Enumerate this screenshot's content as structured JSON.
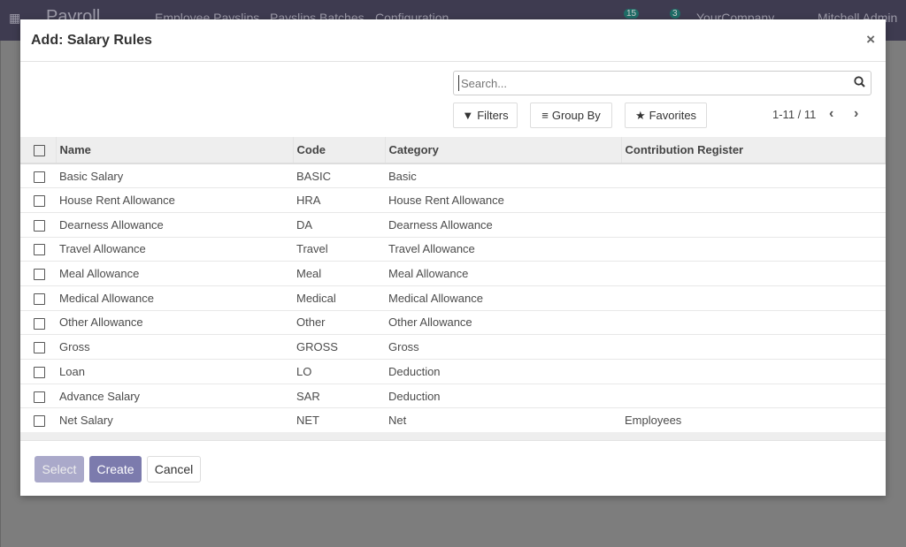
{
  "navbar": {
    "app": "Payroll",
    "menu": [
      "Employee Payslips",
      "Payslips Batches",
      "Configuration"
    ],
    "activity_count": "15",
    "message_count": "3",
    "company": "YourCompany",
    "user": "Mitchell Admin"
  },
  "dialog": {
    "title": "Add: Salary Rules",
    "search_placeholder": "Search...",
    "filters_label": "Filters",
    "groupby_label": "Group By",
    "favorites_label": "Favorites",
    "pager": "1-11 / 11",
    "columns": [
      "Name",
      "Code",
      "Category",
      "Contribution Register"
    ],
    "rows": [
      [
        "Basic Salary",
        "BASIC",
        "Basic",
        ""
      ],
      [
        "House Rent Allowance",
        "HRA",
        "House Rent Allowance",
        ""
      ],
      [
        "Dearness Allowance",
        "DA",
        "Dearness Allowance",
        ""
      ],
      [
        "Travel Allowance",
        "Travel",
        "Travel Allowance",
        ""
      ],
      [
        "Meal Allowance",
        "Meal",
        "Meal Allowance",
        ""
      ],
      [
        "Medical Allowance",
        "Medical",
        "Medical Allowance",
        ""
      ],
      [
        "Other Allowance",
        "Other",
        "Other Allowance",
        ""
      ],
      [
        "Gross",
        "GROSS",
        "Gross",
        ""
      ],
      [
        "Loan",
        "LO",
        "Deduction",
        ""
      ],
      [
        "Advance Salary",
        "SAR",
        "Deduction",
        ""
      ],
      [
        "Net Salary",
        "NET",
        "Net",
        "Employees"
      ]
    ],
    "select_label": "Select",
    "create_label": "Create",
    "cancel_label": "Cancel"
  },
  "colors": {
    "primary": "#7c7bad",
    "primary_disabled": "#aaa9ca",
    "navbar": "#3e3b50"
  }
}
